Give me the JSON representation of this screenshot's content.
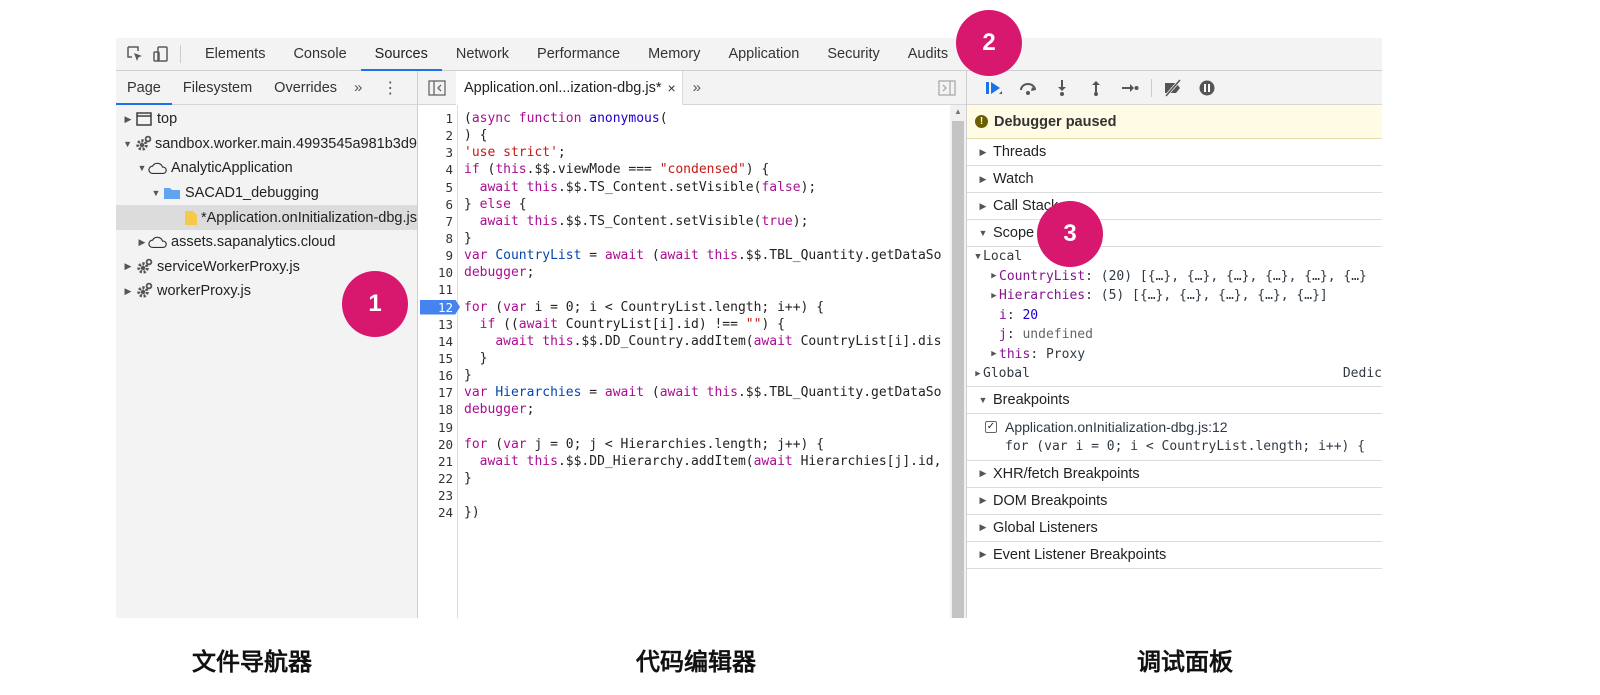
{
  "main_tabs": [
    "Elements",
    "Console",
    "Sources",
    "Network",
    "Performance",
    "Memory",
    "Application",
    "Security",
    "Audits"
  ],
  "active_main_tab": "Sources",
  "navigator": {
    "tabs": [
      "Page",
      "Filesystem",
      "Overrides"
    ],
    "more": "»",
    "tree": [
      {
        "label": "top",
        "icon": "frame-icon",
        "depth": 0,
        "expanded": false,
        "selected": false
      },
      {
        "label": "sandbox.worker.main.4993545a981b3d9",
        "icon": "gear-icon",
        "depth": 0,
        "expanded": true,
        "selected": false
      },
      {
        "label": "AnalyticApplication",
        "icon": "cloud-icon",
        "depth": 1,
        "expanded": true,
        "selected": false
      },
      {
        "label": "SACAD1_debugging",
        "icon": "folder-icon",
        "depth": 2,
        "expanded": true,
        "selected": false
      },
      {
        "label": "*Application.onInitialization-dbg.js",
        "icon": "file-icon",
        "depth": 3,
        "expanded": null,
        "selected": true
      },
      {
        "label": "assets.sapanalytics.cloud",
        "icon": "cloud-icon",
        "depth": 1,
        "expanded": false,
        "selected": false
      },
      {
        "label": "serviceWorkerProxy.js",
        "icon": "gear-icon",
        "depth": 0,
        "expanded": false,
        "selected": false
      },
      {
        "label": "workerProxy.js",
        "icon": "gear-icon",
        "depth": 0,
        "expanded": false,
        "selected": false
      }
    ]
  },
  "editor": {
    "file_tab": "Application.onl...ization-dbg.js*",
    "close": "×",
    "more": "»",
    "breakpoint_line": 12,
    "lines": [
      "(async function anonymous(",
      ") {",
      "'use strict';",
      "if (this.$$.viewMode === \"condensed\") {",
      "  await this.$$.TS_Content.setVisible(false);",
      "} else {",
      "  await this.$$.TS_Content.setVisible(true);",
      "}",
      "var CountryList = await (await this.$$.TBL_Quantity.getDataSo",
      "debugger;",
      "",
      "for (var i = 0; i < CountryList.length; i++) {",
      "  if ((await CountryList[i].id) !== \"\") {",
      "    await this.$$.DD_Country.addItem(await CountryList[i].dis",
      "  }",
      "}",
      "var Hierarchies = await (await this.$$.TBL_Quantity.getDataSo",
      "debugger;",
      "",
      "for (var j = 0; j < Hierarchies.length; j++) {",
      "  await this.$$.DD_Hierarchy.addItem(await Hierarchies[j].id,",
      "}",
      "",
      "})"
    ]
  },
  "debugger": {
    "paused_label": "Debugger paused",
    "sections_top": [
      "Threads",
      "Watch",
      "Call Stack"
    ],
    "scope_label": "Scope",
    "local_label": "Local",
    "scope_vars": [
      {
        "name": "CountryList",
        "sep": ": ",
        "value": "(20) [{…}, {…}, {…}, {…}, {…}, {…}",
        "expandable": true
      },
      {
        "name": "Hierarchies",
        "sep": ": ",
        "value": "(5) [{…}, {…}, {…}, {…}, {…}]",
        "expandable": true
      },
      {
        "name": "i",
        "sep": ": ",
        "value": "20",
        "expandable": false
      },
      {
        "name": "j",
        "sep": ": ",
        "value": "undefined",
        "expandable": false
      },
      {
        "name": "this",
        "sep": ": ",
        "value": "Proxy",
        "expandable": true
      }
    ],
    "global_label": "Global",
    "global_value": "Dedic",
    "breakpoints_label": "Breakpoints",
    "breakpoint_file": "Application.onInitialization-dbg.js:12",
    "breakpoint_code": "for (var i = 0; i < CountryList.length; i++) {",
    "sections_bottom": [
      "XHR/fetch Breakpoints",
      "DOM Breakpoints",
      "Global Listeners",
      "Event Listener Breakpoints"
    ]
  },
  "markers": [
    "1",
    "2",
    "3"
  ],
  "captions": {
    "navigator": "文件导航器",
    "editor": "代码编辑器",
    "debugger": "调试面板"
  },
  "colors": {
    "accent": "#1a73e8",
    "marker": "#d8186e",
    "breakpoint": "#4683f0",
    "paused_bg": "#fffbe5"
  }
}
